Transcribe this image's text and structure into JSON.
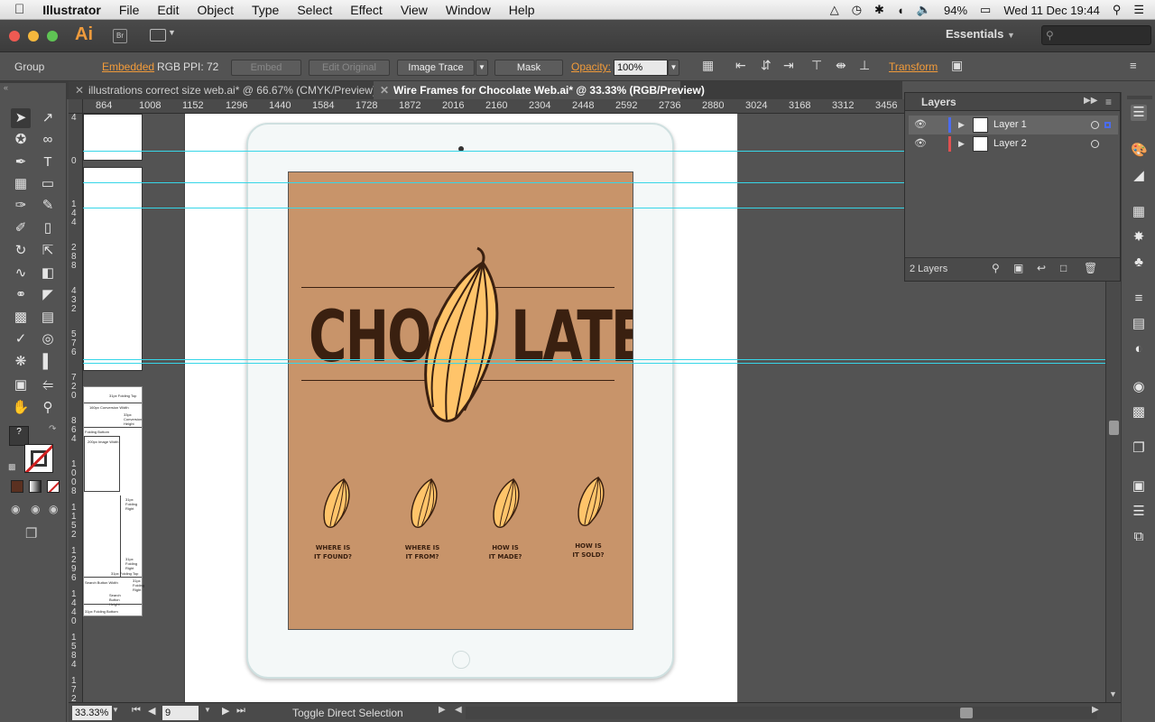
{
  "menubar": {
    "app_name": "Illustrator",
    "items": [
      "File",
      "Edit",
      "Object",
      "Type",
      "Select",
      "Effect",
      "View",
      "Window",
      "Help"
    ],
    "battery": "94%",
    "clock": "Wed 11 Dec  19:44"
  },
  "appbar": {
    "logo": "Ai",
    "bridge": "Br",
    "workspace": "Essentials"
  },
  "controlbar": {
    "selection_type": "Group",
    "embedded": "Embedded",
    "color_mode": "RGB",
    "ppi": "PPI: 72",
    "embed_btn": "Embed",
    "edit_original_btn": "Edit Original",
    "image_trace_btn": "Image Trace",
    "mask_btn": "Mask",
    "opacity_label": "Opacity:",
    "opacity_value": "100%",
    "transform_link": "Transform"
  },
  "tabs": [
    {
      "label": "illustrations correct size web.ai* @ 66.67% (CMYK/Preview)",
      "active": false
    },
    {
      "label": "Wire Frames for Chocolate Web.ai* @ 33.33% (RGB/Preview)",
      "active": true
    }
  ],
  "ruler_top": [
    "864",
    "1008",
    "1152",
    "1296",
    "1440",
    "1584",
    "1728",
    "1872",
    "2016",
    "2160",
    "2304",
    "2448",
    "2592",
    "2736",
    "2880",
    "3024",
    "3168",
    "3312",
    "3456"
  ],
  "ruler_left": [
    "4",
    "0",
    "144",
    "288",
    "432",
    "576",
    "720",
    "864",
    "1008",
    "1152",
    "1296",
    "1440",
    "1584",
    "1728"
  ],
  "artwork": {
    "title_left": "CHOC",
    "title_right": "LATE",
    "captions": [
      "WHERE IS\nIT FOUND?",
      "WHERE IS\nIT FROM?",
      "HOW IS\nIT MADE?",
      "HOW IS\nIT SOLD?"
    ],
    "bg_color": "#c8946a",
    "pod_color": "#ffc46a",
    "ink_color": "#3a2010"
  },
  "wireframe_labels": [
    "31px Folding Top",
    "160px Conversion Width",
    "33px Conversion Height",
    "Folding Bottom",
    "200px Image Width",
    "31px Folding Right",
    "31px Folding Right",
    "31px Folding Top",
    "Search Button Width",
    "31px Folding Right",
    "Search Button Height",
    "31px Folding Bottom"
  ],
  "layers": {
    "title": "Layers",
    "rows": [
      {
        "name": "Layer 1",
        "color": "#4b6cf0"
      },
      {
        "name": "Layer 2",
        "color": "#e05050"
      }
    ],
    "count": "2 Layers"
  },
  "statusbar": {
    "zoom": "33.33%",
    "artboard": "9",
    "tool_status": "Toggle Direct Selection"
  }
}
